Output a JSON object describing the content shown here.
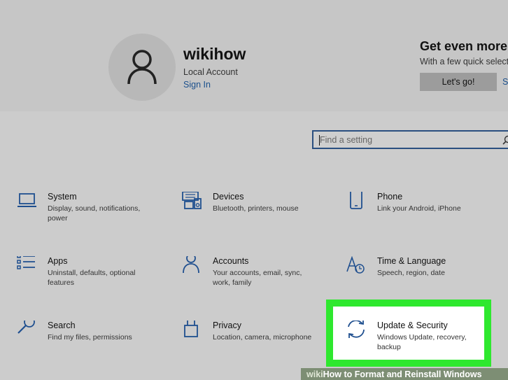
{
  "user": {
    "name": "wikihow",
    "account_type": "Local Account",
    "sign_in": "Sign In"
  },
  "promo": {
    "title": "Get even more o",
    "subtitle": "With a few quick selectio",
    "button": "Let's go!",
    "skip": "Sk"
  },
  "search": {
    "placeholder": "Find a setting"
  },
  "categories": [
    {
      "title": "System",
      "desc": "Display, sound, notifications, power",
      "icon": "laptop-icon"
    },
    {
      "title": "Devices",
      "desc": "Bluetooth, printers, mouse",
      "icon": "devices-icon"
    },
    {
      "title": "Phone",
      "desc": "Link your Android, iPhone",
      "icon": "phone-icon"
    },
    {
      "title": "Apps",
      "desc": "Uninstall, defaults, optional features",
      "icon": "apps-list-icon"
    },
    {
      "title": "Accounts",
      "desc": "Your accounts, email, sync, work, family",
      "icon": "person-icon"
    },
    {
      "title": "Time & Language",
      "desc": "Speech, region, date",
      "icon": "time-language-icon"
    },
    {
      "title": "Search",
      "desc": "Find my files, permissions",
      "icon": "magnifier-icon"
    },
    {
      "title": "Privacy",
      "desc": "Location, camera, microphone",
      "icon": "lock-icon"
    },
    {
      "title": "Update & Security",
      "desc": "Windows Update, recovery, backup",
      "icon": "sync-arrows-icon"
    }
  ],
  "highlight_color": "#2ee82e",
  "accent_color": "#1a4f8c",
  "watermark": {
    "wiki": "wiki",
    "text": "How to Format and Reinstall Windows"
  }
}
